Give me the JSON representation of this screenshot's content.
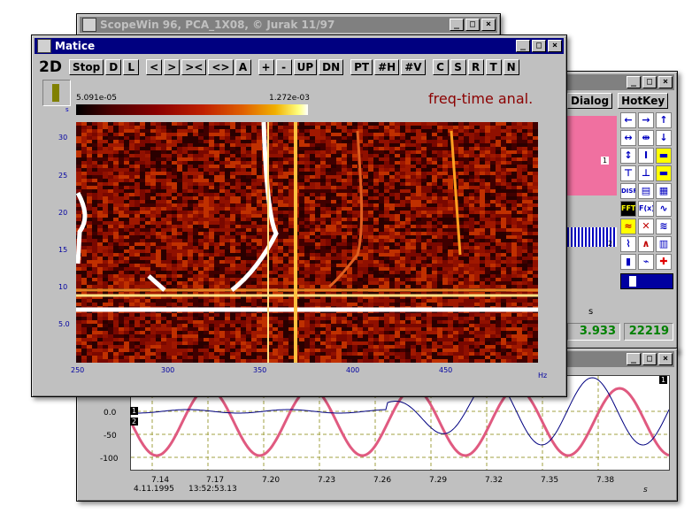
{
  "scopewin": {
    "title": "ScopeWin 96, PCA_1X08, © Jurak 11/97",
    "buttons": [
      "_",
      "□",
      "×"
    ]
  },
  "matice": {
    "title": "Matice",
    "buttons": [
      "_",
      "□",
      "×"
    ],
    "mode": "2D",
    "toolbar": [
      "Stop",
      "D",
      "L",
      "<",
      ">",
      "><",
      "<>",
      "A",
      "+",
      "-",
      "UP",
      "DN",
      "PT",
      "#H",
      "#V",
      "C",
      "S",
      "R",
      "T",
      "N"
    ],
    "colorbar": {
      "min": "5.091e-05",
      "max": "1.272e-03"
    },
    "caption": "freq-time anal.",
    "caption_color": "#8b0000",
    "y_ticks": [
      "30",
      "25",
      "20",
      "15",
      "10",
      "5.0"
    ],
    "x_ticks": [
      "250",
      "300",
      "350",
      "400",
      "450"
    ],
    "x_unit": "Hz",
    "small_label": "s"
  },
  "dialogwin": {
    "buttons": [
      "_",
      "□",
      "×"
    ],
    "menu": [
      "Dialog",
      "HotKey"
    ],
    "marker_1": "1",
    "marker_2": "2",
    "readout_unit": "s",
    "readout_value": "3.933",
    "readout_count": "22219",
    "icons": [
      "arrow-left-icon",
      "arrow-right-icon",
      "arrow-up-icon",
      "expand-h-icon",
      "compress-h-icon",
      "arrow-down-icon",
      "expand-v-icon",
      "compress-v-icon",
      "panel-icon",
      "split-icon",
      "split-icon-2",
      "panel-icon-2",
      "display-icon",
      "print-icon",
      "list-icon",
      "fft-icon",
      "fx-icon",
      "sine-icon",
      "wave-icon",
      "cross-wave-icon",
      "wave-icon-2",
      "scope-icon",
      "peak-icon",
      "graph-icon",
      "bars-icon",
      "chart-icon",
      "plus-icon"
    ]
  },
  "scope": {
    "buttons": [
      "_",
      "□",
      "×"
    ],
    "marker": "1",
    "y_ticks": [
      "0.0",
      "-50",
      "-100"
    ],
    "x_ticks": [
      "7.14",
      "7.17",
      "7.20",
      "7.23",
      "7.26",
      "7.29",
      "7.32",
      "7.35",
      "7.38"
    ],
    "x_unit": "s",
    "date": "4.11.1995",
    "time": "13:52:53.13",
    "channel_1": "1",
    "channel_2": "2",
    "colors": {
      "ch1": "#e05a80",
      "ch2": "#000080",
      "grid": "#a0a040"
    }
  }
}
